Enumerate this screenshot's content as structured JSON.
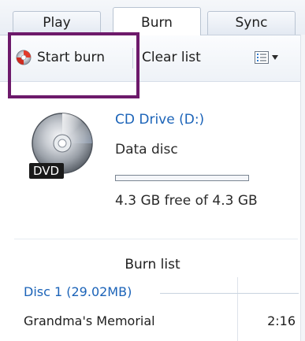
{
  "tabs": [
    {
      "label": "Play",
      "active": false
    },
    {
      "label": "Burn",
      "active": true
    },
    {
      "label": "Sync",
      "active": false
    }
  ],
  "toolbar": {
    "start_burn_label": "Start burn",
    "clear_list_label": "Clear list",
    "options_icon": "list-options-icon",
    "dropdown_icon": "chevron-down-icon"
  },
  "device": {
    "name": "CD Drive (D:)",
    "type": "Data disc",
    "free_text": "4.3 GB free of 4.3 GB",
    "used_fraction": 0.0,
    "icon_label": "DVD",
    "icon": "dvd-disc-icon"
  },
  "burn_list": {
    "label": "Burn list",
    "disc_header": "Disc 1 (29.02MB)",
    "items": [
      {
        "title": "Grandma's Memorial",
        "duration": "2:16"
      }
    ]
  },
  "colors": {
    "accent": "#1b63b8",
    "highlight_border": "#6d1a6b"
  }
}
